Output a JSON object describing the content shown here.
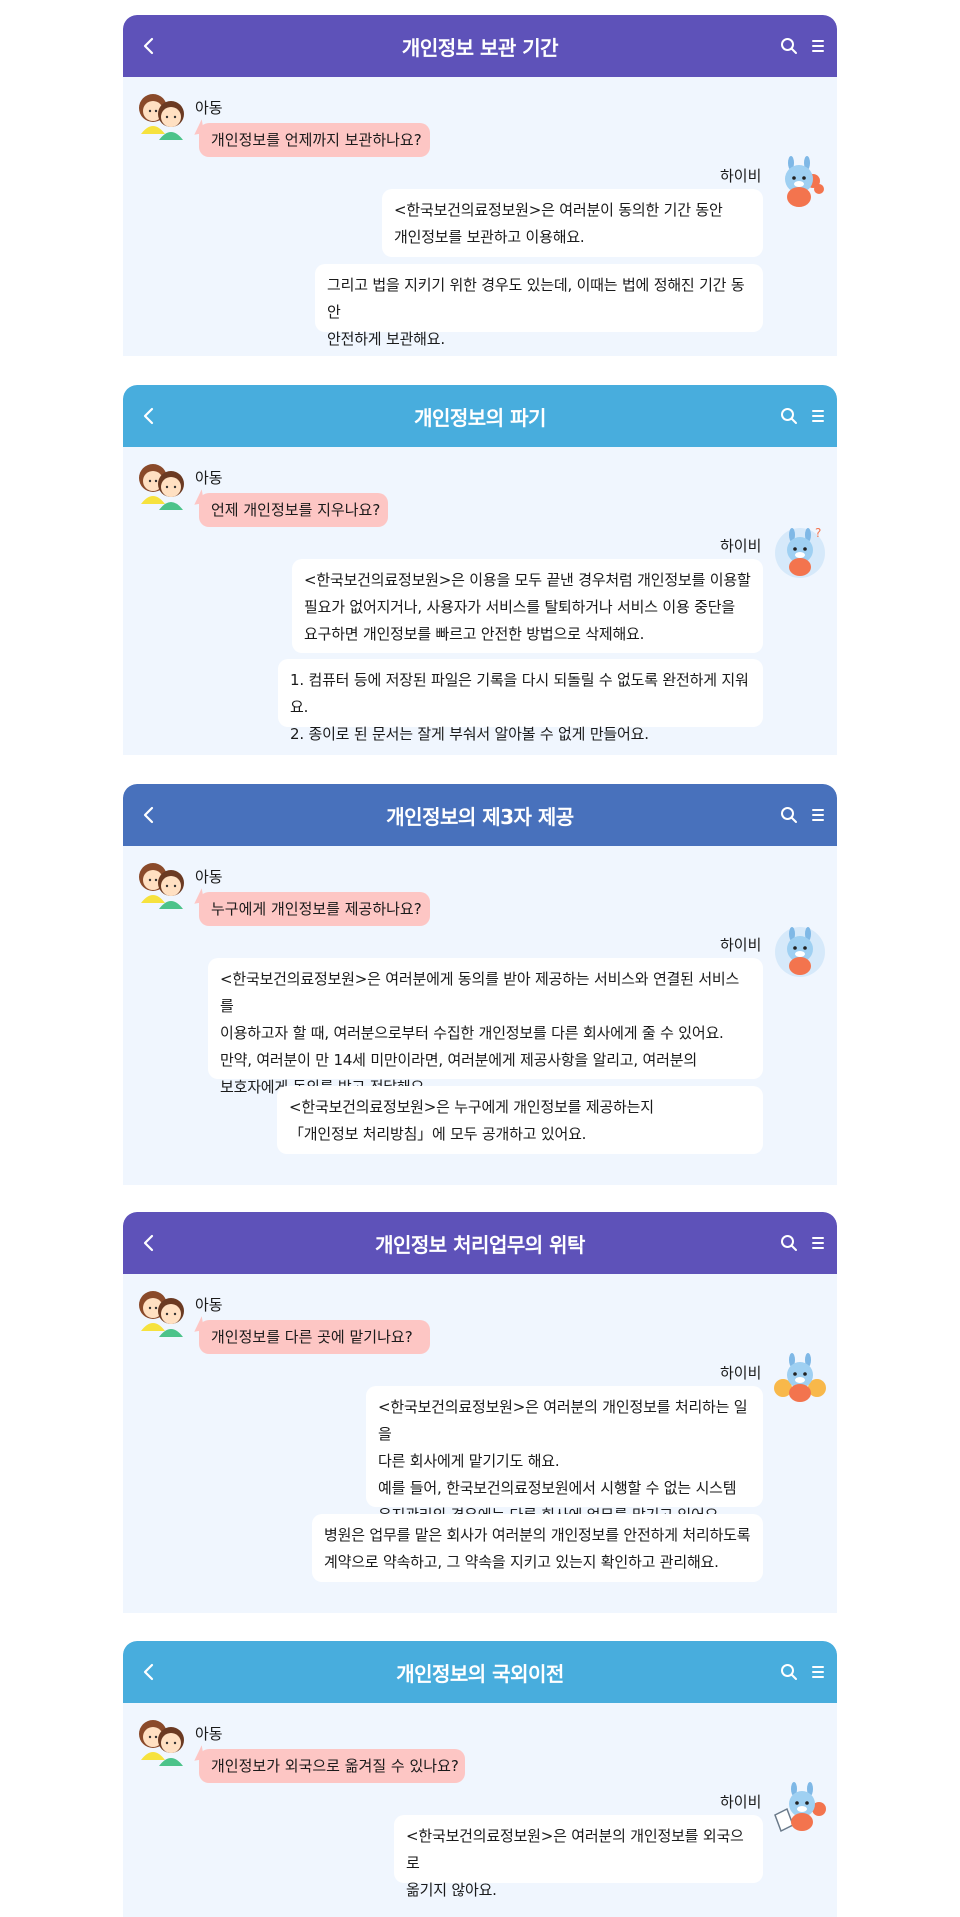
{
  "colors": {
    "header_purple": "#5e52b9",
    "header_sky": "#48addd",
    "header_blue": "#4871bc",
    "panel_bg": "#f0f6fe",
    "question_bubble": "#fdc6c4",
    "answer_bubble": "#ffffff"
  },
  "icons": {
    "back": "chevron-left-icon",
    "search": "search-icon",
    "menu": "menu-icon"
  },
  "sections": [
    {
      "title": "개인정보 보관 기간",
      "child_name": "아동",
      "question": "개인정보를 언제까지 보관하나요?",
      "bot_name": "하이비",
      "answers": [
        "<한국보건의료정보원>은 여러분이 동의한 기간 동안\n개인정보를 보관하고 이용해요.",
        "그리고 법을 지키기 위한 경우도 있는데, 이때는 법에 정해진 기간 동안\n안전하게 보관해요."
      ]
    },
    {
      "title": "개인정보의 파기",
      "child_name": "아동",
      "question": "언제 개인정보를 지우나요?",
      "bot_name": "하이비",
      "answers": [
        "<한국보건의료정보원>은 이용을 모두 끝낸 경우처럼 개인정보를 이용할\n필요가 없어지거나, 사용자가 서비스를 탈퇴하거나 서비스 이용 중단을\n요구하면 개인정보를 빠르고 안전한 방법으로 삭제해요.",
        "1. 컴퓨터 등에 저장된 파일은 기록을 다시 되돌릴 수 없도록 완전하게 지워요.\n2. 종이로 된 문서는 잘게 부숴서 알아볼 수 없게 만들어요."
      ]
    },
    {
      "title": "개인정보의 제3자 제공",
      "child_name": "아동",
      "question": "누구에게 개인정보를 제공하나요?",
      "bot_name": "하이비",
      "answers": [
        "<한국보건의료정보원>은 여러분에게 동의를 받아 제공하는 서비스와 연결된 서비스를\n이용하고자 할 때, 여러분으로부터 수집한 개인정보를 다른 회사에게 줄 수 있어요.\n만약, 여러분이 만 14세 미만이라면, 여러분에게 제공사항을 알리고, 여러분의\n보호자에게 동의를 받고 전달해요.",
        "<한국보건의료정보원>은 누구에게 개인정보를 제공하는지\n「개인정보 처리방침」에 모두 공개하고 있어요."
      ]
    },
    {
      "title": "개인정보 처리업무의 위탁",
      "child_name": "아동",
      "question": "개인정보를 다른 곳에 맡기나요?",
      "bot_name": "하이비",
      "answers": [
        "<한국보건의료정보원>은 여러분의 개인정보를 처리하는 일을\n다른 회사에게 맡기기도 해요.\n예를 들어, 한국보건의료정보원에서 시행할 수 없는 시스템\n유지관리의 경우에는 다른 회사에 업무를 맡기고 있어요.",
        "병원은 업무를 맡은 회사가 여러분의 개인정보를 안전하게 처리하도록\n계약으로 약속하고, 그 약속을 지키고 있는지 확인하고 관리해요."
      ]
    },
    {
      "title": "개인정보의 국외이전",
      "child_name": "아동",
      "question": "개인정보가 외국으로 옮겨질 수 있나요?",
      "bot_name": "하이비",
      "answers": [
        "<한국보건의료정보원>은 여러분의 개인정보를 외국으로\n옮기지 않아요."
      ]
    }
  ]
}
